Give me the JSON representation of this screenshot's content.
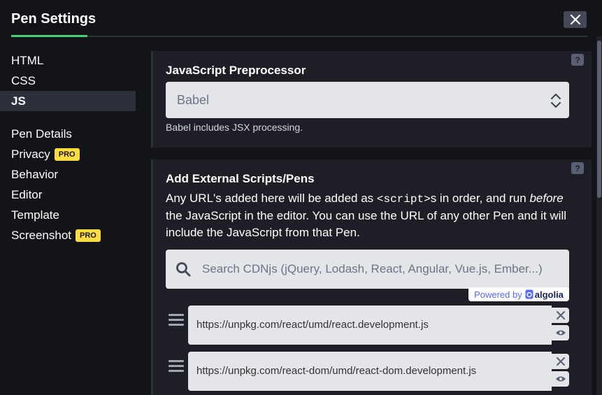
{
  "header": {
    "title": "Pen Settings",
    "close_icon": "close-icon"
  },
  "nav": {
    "group1": [
      {
        "label": "HTML",
        "active": false
      },
      {
        "label": "CSS",
        "active": false
      },
      {
        "label": "JS",
        "active": true
      }
    ],
    "group2": [
      {
        "label": "Pen Details"
      },
      {
        "label": "Privacy",
        "badge": "PRO"
      },
      {
        "label": "Behavior"
      },
      {
        "label": "Editor"
      },
      {
        "label": "Template"
      },
      {
        "label": "Screenshot",
        "badge": "PRO"
      }
    ]
  },
  "preprocessor": {
    "title": "JavaScript Preprocessor",
    "help": "?",
    "selected": "Babel",
    "hint": "Babel includes JSX processing."
  },
  "external": {
    "title": "Add External Scripts/Pens",
    "help": "?",
    "desc_before": "Any URL's added here will be added as ",
    "desc_code": "<script>",
    "desc_middle": "s in order, and run ",
    "desc_em": "before",
    "desc_after": " the JavaScript in the editor. You can use the URL of any other Pen and it will include the JavaScript from that Pen.",
    "search_placeholder": "Search CDNjs (jQuery, Lodash, React, Angular, Vue.js, Ember...)",
    "powered_by": "Powered by",
    "algolia": "algolia",
    "resources": [
      "https://unpkg.com/react/umd/react.development.js",
      "https://unpkg.com/react-dom/umd/react-dom.development.js"
    ]
  },
  "colors": {
    "accent": "#47cf73",
    "pro_badge": "#ffdd40",
    "background": "#131417",
    "panel": "#1e1f26"
  }
}
